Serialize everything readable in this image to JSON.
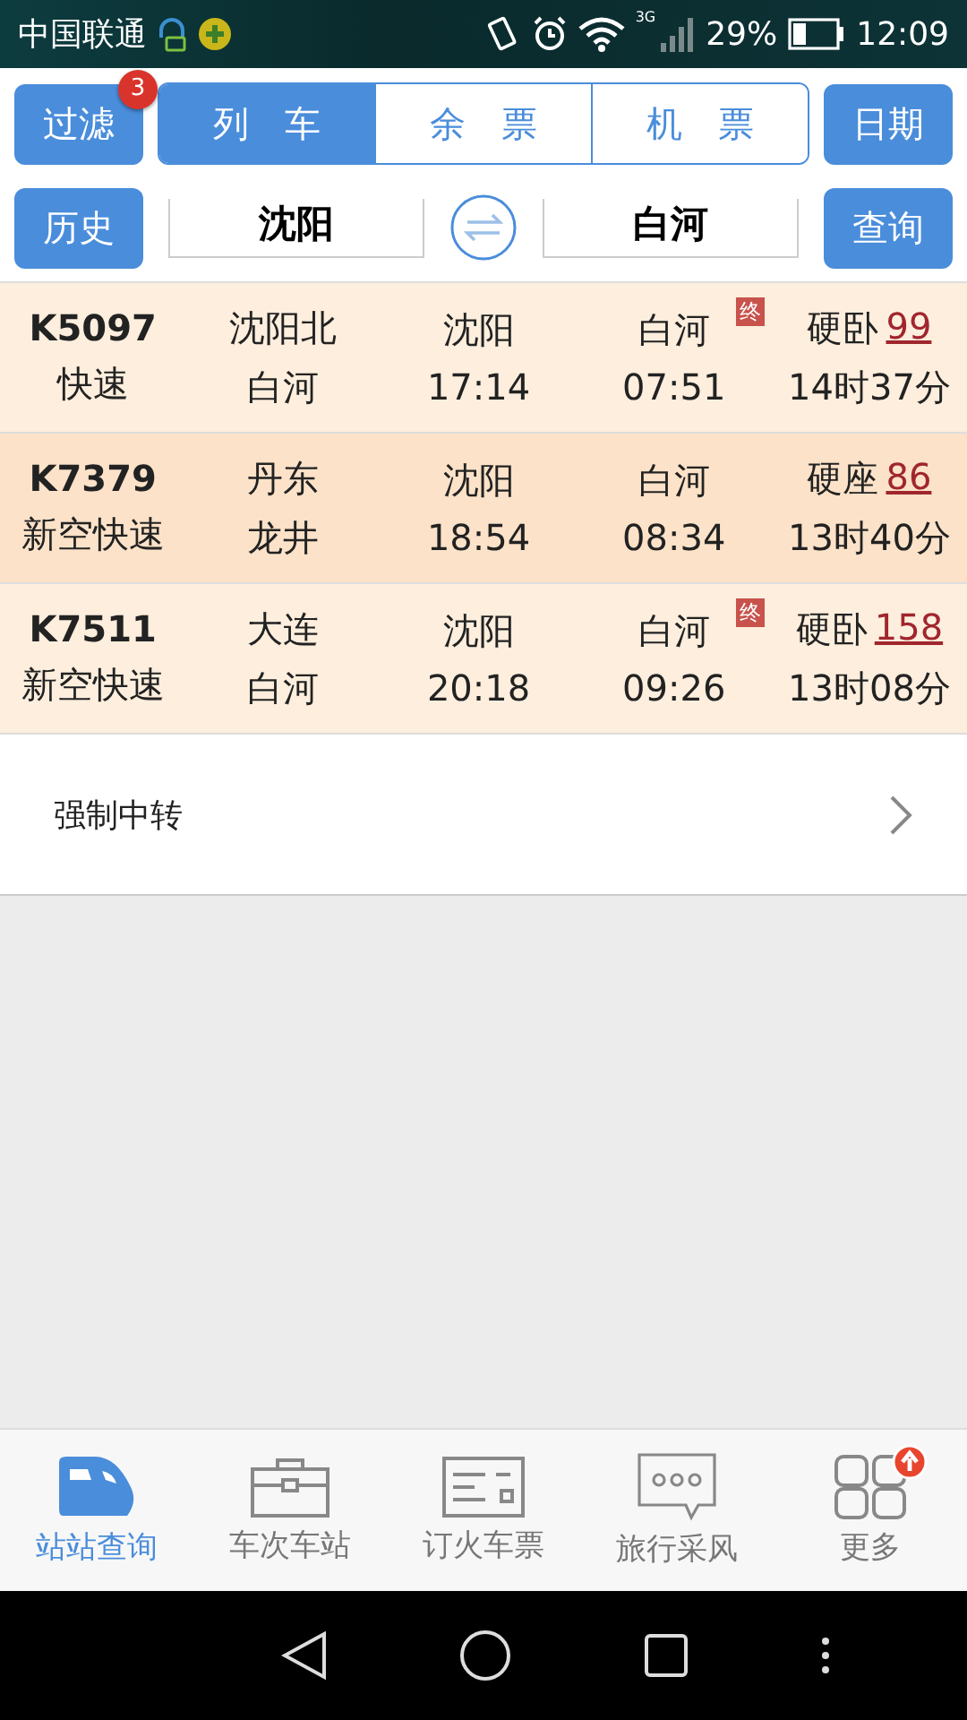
{
  "status_bar": {
    "carrier": "中国联通",
    "network": "3G",
    "battery": "29%",
    "time": "12:09"
  },
  "toolbar": {
    "filter_button": "过滤",
    "filter_badge": "3",
    "date_button": "日期",
    "tabs": [
      {
        "label": "列　车",
        "selected": true
      },
      {
        "label": "余　票",
        "selected": false
      },
      {
        "label": "机　票",
        "selected": false
      }
    ]
  },
  "route": {
    "history_button": "历史",
    "from": "沈阳",
    "to": "白河",
    "search_button": "查询"
  },
  "trains": [
    {
      "train": "K5097",
      "type": "快速",
      "origin": "沈阳北",
      "terminus": "白河",
      "depart_station": "沈阳",
      "depart_time": "17:14",
      "arrive_station": "白河",
      "arrive_time": "07:51",
      "end_badge": "终",
      "seat": "硬卧",
      "seats_left": "99",
      "duration": "14时37分",
      "selected": false
    },
    {
      "train": "K7379",
      "type": "新空快速",
      "origin": "丹东",
      "terminus": "龙井",
      "depart_station": "沈阳",
      "depart_time": "18:54",
      "arrive_station": "白河",
      "arrive_time": "08:34",
      "seat": "硬座",
      "seats_left": "86",
      "duration": "13时40分",
      "selected": true
    },
    {
      "train": "K7511",
      "type": "新空快速",
      "origin": "大连",
      "terminus": "白河",
      "depart_station": "沈阳",
      "depart_time": "20:18",
      "arrive_station": "白河",
      "arrive_time": "09:26",
      "end_badge": "终",
      "seat": "硬卧",
      "seats_left": "158",
      "duration": "13时08分",
      "selected": false
    }
  ],
  "transfer_link": "强制中转",
  "bottom_nav": [
    {
      "label": "站站查询",
      "kind": "train",
      "selected": true
    },
    {
      "label": "车次车站",
      "kind": "case",
      "selected": false
    },
    {
      "label": "订火车票",
      "kind": "ticket",
      "selected": false
    },
    {
      "label": "旅行采风",
      "kind": "chat",
      "selected": false
    },
    {
      "label": "更多",
      "kind": "grid",
      "selected": false,
      "badge": true
    }
  ]
}
